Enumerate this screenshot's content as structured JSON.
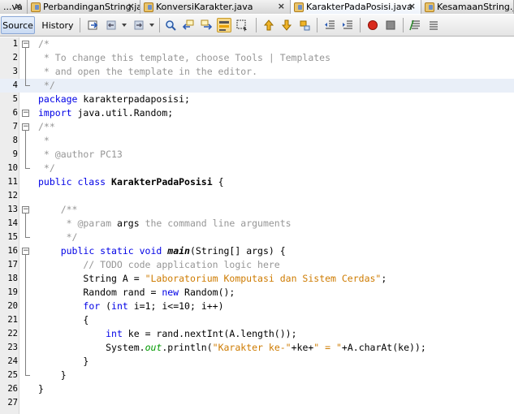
{
  "tabs": [
    {
      "label": "...va",
      "close": "×"
    },
    {
      "label": "PerbandinganString.java",
      "close": "×"
    },
    {
      "label": "KonversiKarakter.java",
      "close": "×"
    },
    {
      "label": "KarakterPadaPosisi.java",
      "close": "×",
      "active": true
    },
    {
      "label": "KesamaanString.j"
    }
  ],
  "toolbar": {
    "source_label": "Source",
    "history_label": "History",
    "icons": [
      "last-edit-icon",
      "back-icon",
      "forward-icon",
      "find-icon",
      "find-previous-icon",
      "find-next-icon",
      "toggle-highlight-icon",
      "find-selection-icon",
      "previous-bookmark-icon",
      "next-bookmark-icon",
      "toggle-bookmark-icon",
      "shift-left-icon",
      "shift-right-icon",
      "start-macro-icon",
      "stop-macro-icon",
      "comment-icon",
      "uncomment-icon"
    ]
  },
  "editor": {
    "lines": [
      {
        "n": "1",
        "t": [
          [
            "cm",
            "/*"
          ]
        ]
      },
      {
        "n": "2",
        "t": [
          [
            "cm",
            " * To change this template, choose Tools | Templates"
          ]
        ]
      },
      {
        "n": "3",
        "t": [
          [
            "cm",
            " * and open the template in the editor."
          ]
        ]
      },
      {
        "n": "4",
        "t": [
          [
            "cm",
            " */"
          ]
        ]
      },
      {
        "n": "5",
        "t": [
          [
            "kw",
            "package"
          ],
          [
            "",
            " karakterpadaposisi;"
          ]
        ]
      },
      {
        "n": "6",
        "t": [
          [
            "kw",
            "import"
          ],
          [
            "",
            " java.util.Random;"
          ]
        ]
      },
      {
        "n": "7",
        "t": [
          [
            "cm",
            "/**"
          ]
        ]
      },
      {
        "n": "8",
        "t": [
          [
            "cm",
            " *"
          ]
        ]
      },
      {
        "n": "9",
        "t": [
          [
            "cm",
            " * @author PC13"
          ]
        ]
      },
      {
        "n": "10",
        "t": [
          [
            "cm",
            " */"
          ]
        ]
      },
      {
        "n": "11",
        "t": [
          [
            "kw",
            "public class"
          ],
          [
            "",
            " "
          ],
          [
            "cls",
            "KarakterPadaPosisi"
          ],
          [
            "",
            " {"
          ]
        ]
      },
      {
        "n": "12",
        "t": []
      },
      {
        "n": "13",
        "t": [
          [
            "cm",
            "    /**"
          ]
        ]
      },
      {
        "n": "14",
        "t": [
          [
            "cm",
            "     * @param "
          ],
          [
            "",
            "args"
          ],
          [
            "cm",
            " the command line arguments"
          ]
        ]
      },
      {
        "n": "15",
        "t": [
          [
            "cm",
            "     */"
          ]
        ]
      },
      {
        "n": "16",
        "t": [
          [
            "",
            "    "
          ],
          [
            "kw",
            "public static void"
          ],
          [
            "",
            " "
          ],
          [
            "mth",
            "main"
          ],
          [
            "",
            "(String[] args) {"
          ]
        ]
      },
      {
        "n": "17",
        "t": [
          [
            "cm",
            "        // TODO code application logic here"
          ]
        ]
      },
      {
        "n": "18",
        "t": [
          [
            "",
            "        String A = "
          ],
          [
            "st",
            "\"Laboratorium Komputasi dan Sistem Cerdas\""
          ],
          [
            "",
            ";"
          ]
        ]
      },
      {
        "n": "19",
        "t": [
          [
            "",
            "        Random rand = "
          ],
          [
            "kw",
            "new"
          ],
          [
            "",
            " Random();"
          ]
        ]
      },
      {
        "n": "20",
        "t": [
          [
            "",
            "        "
          ],
          [
            "kw",
            "for"
          ],
          [
            "",
            " ("
          ],
          [
            "kw",
            "int"
          ],
          [
            "",
            " i=1; i<=10; i++)"
          ]
        ]
      },
      {
        "n": "21",
        "t": [
          [
            "",
            "        {"
          ]
        ]
      },
      {
        "n": "22",
        "t": [
          [
            "",
            "            "
          ],
          [
            "kw",
            "int"
          ],
          [
            "",
            " ke = rand.nextInt(A.length());"
          ]
        ]
      },
      {
        "n": "23",
        "t": [
          [
            "",
            "            System."
          ],
          [
            "fld",
            "out"
          ],
          [
            "",
            ".println("
          ],
          [
            "st",
            "\"Karakter ke-\""
          ],
          [
            "",
            "+ke+"
          ],
          [
            "st",
            "\" = \""
          ],
          [
            "",
            "+A.charAt(ke));"
          ]
        ]
      },
      {
        "n": "24",
        "t": [
          [
            "",
            "        }"
          ]
        ]
      },
      {
        "n": "25",
        "t": [
          [
            "",
            "    }"
          ]
        ]
      },
      {
        "n": "26",
        "t": [
          [
            "",
            "}"
          ]
        ]
      },
      {
        "n": "27",
        "t": []
      }
    ],
    "highlighted_line": "4"
  }
}
